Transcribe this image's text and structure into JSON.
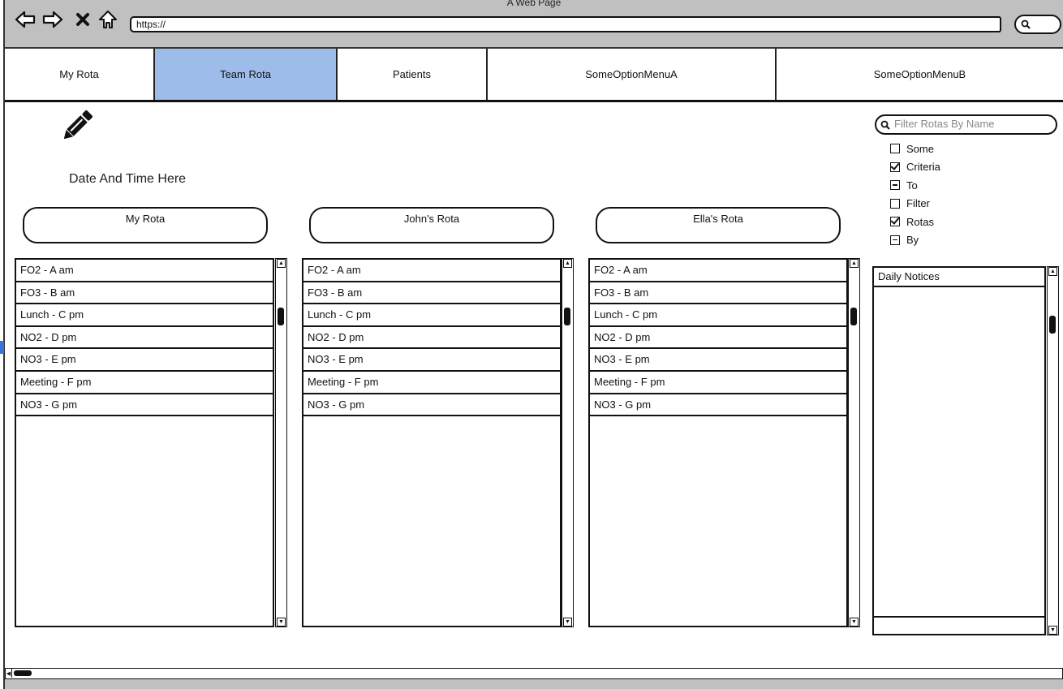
{
  "browser": {
    "title": "A Web Page",
    "url": "https://",
    "nav_icons": [
      "back-arrow-icon",
      "forward-arrow-icon",
      "close-x-icon",
      "home-icon"
    ],
    "search_icon": "search-icon"
  },
  "tabs": [
    {
      "label": "My Rota",
      "active": false
    },
    {
      "label": "Team Rota",
      "active": true
    },
    {
      "label": "Patients",
      "active": false
    },
    {
      "label": "SomeOptionMenuA",
      "active": false
    },
    {
      "label": "SomeOptionMenuB",
      "active": false
    }
  ],
  "colors": {
    "active_tab": "#9dbcea",
    "chrome_bg": "#c0c0c0"
  },
  "main": {
    "edit_icon": "pencil-icon",
    "date_time": "Date And Time Here"
  },
  "rotas": [
    {
      "title": "My Rota",
      "items": [
        "FO2 - A am",
        "FO3 - B am",
        "Lunch - C pm",
        "NO2 - D pm",
        "NO3 - E pm",
        "Meeting - F pm",
        "NO3 - G pm"
      ]
    },
    {
      "title": "John's Rota",
      "items": [
        "FO2 - A am",
        "FO3 - B am",
        "Lunch - C pm",
        "NO2 - D pm",
        "NO3 - E pm",
        "Meeting - F pm",
        "NO3 - G pm"
      ]
    },
    {
      "title": "Ella's Rota",
      "items": [
        "FO2 - A am",
        "FO3 - B am",
        "Lunch - C pm",
        "NO2 - D pm",
        "NO3 - E pm",
        "Meeting - F pm",
        "NO3 - G pm"
      ]
    }
  ],
  "filter": {
    "placeholder": "Filter Rotas By Name",
    "value": "",
    "options": [
      {
        "label": "Some",
        "state": "unchecked"
      },
      {
        "label": "Criteria",
        "state": "checked"
      },
      {
        "label": "To",
        "state": "indeterminate"
      },
      {
        "label": "Filter",
        "state": "unchecked"
      },
      {
        "label": "Rotas",
        "state": "checked"
      },
      {
        "label": "By",
        "state": "indeterminate"
      }
    ]
  },
  "notices": {
    "title": "Daily Notices"
  }
}
